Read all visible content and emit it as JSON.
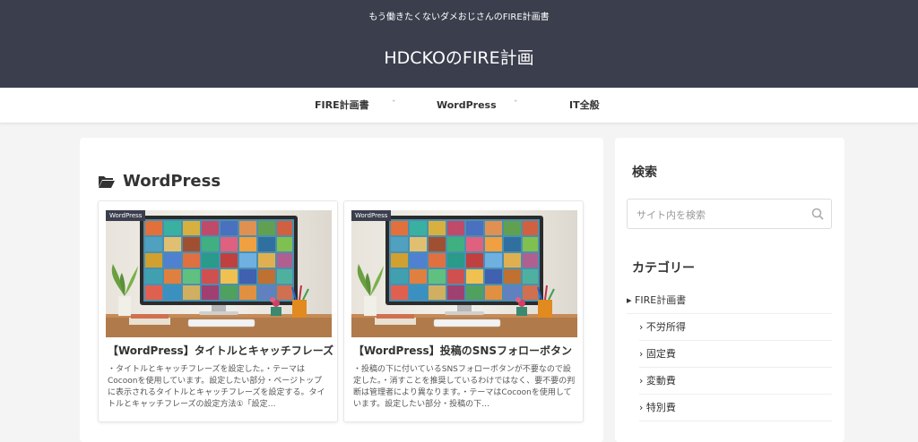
{
  "header": {
    "tagline": "もう働きたくないダメおじさんのFIRE計画書",
    "site_title": "HDCKOのFIRE計画"
  },
  "nav": {
    "items": [
      {
        "label": "FIRE計画書",
        "has_dropdown": true
      },
      {
        "label": "WordPress",
        "has_dropdown": true
      },
      {
        "label": "IT全般",
        "has_dropdown": false
      }
    ],
    "caret": "ˇ"
  },
  "main": {
    "archive_title": "WordPress",
    "cards": [
      {
        "category": "WordPress",
        "title": "【WordPress】タイトルとキャッチフレーズ",
        "snippet": "・タイトルとキャッチフレーズを設定した。・テーマはCocoonを使用しています。設定したい部分・ページトップに表示されるタイトルとキャッチフレーズを設定する。タイトルとキャッチフレーズの設定方法①「設定…"
      },
      {
        "category": "WordPress",
        "title": "【WordPress】投稿のSNSフォローボタン",
        "snippet": "・投稿の下に付いているSNSフォローボタンが不要なので設定した。・消すことを推奨しているわけではなく、要不要の判断は管理者により異なります。・テーマはCocoonを使用しています。設定したい部分・投稿の下…"
      }
    ]
  },
  "sidebar": {
    "search_heading": "検索",
    "search_placeholder": "サイト内を検索",
    "category_heading": "カテゴリー",
    "categories": [
      {
        "label": "FIRE計画書",
        "marker": "▸"
      },
      {
        "label": "不労所得",
        "marker": "›"
      },
      {
        "label": "固定費",
        "marker": "›"
      },
      {
        "label": "変動費",
        "marker": "›"
      },
      {
        "label": "特別費",
        "marker": "›"
      }
    ]
  },
  "colors": {
    "header_bg": "#3a3e4d",
    "page_bg": "#f4f4f4"
  },
  "icons": [
    "folder-open-icon",
    "search-icon"
  ]
}
